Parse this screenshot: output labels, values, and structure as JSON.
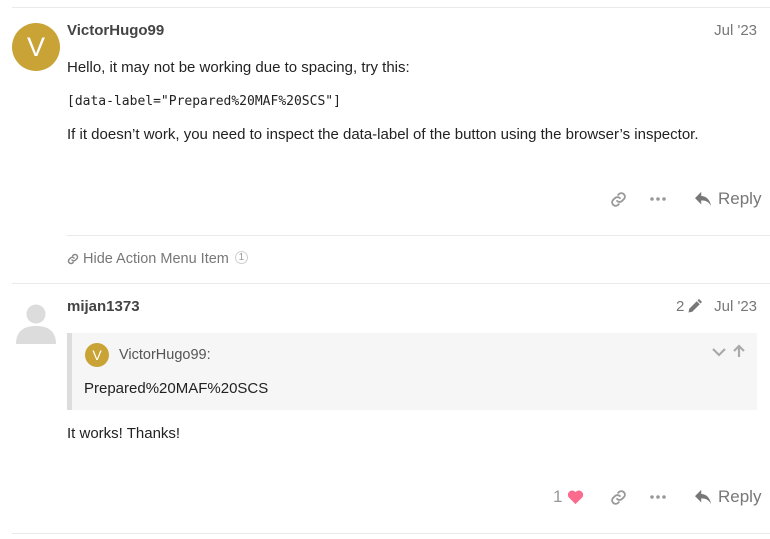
{
  "posts": [
    {
      "avatar_letter": "V",
      "avatar_color": "#c9a336",
      "username": "VictorHugo99",
      "date": "Jul '23",
      "intro": "Hello, it may not be working due to spacing, try this:",
      "code": "[data-label=\"Prepared%20MAF%20SCS\"]",
      "outro": "If it doesn’t work, you need to inspect the data-label of the button using the browser’s inspector.",
      "reply_label": "Reply",
      "link": {
        "title": "Hide Action Menu Item",
        "count": "1"
      }
    },
    {
      "username": "mijan1373",
      "edit_count": "2",
      "date": "Jul '23",
      "quote": {
        "avatar_letter": "V",
        "user": "VictorHugo99:",
        "text": "Prepared%20MAF%20SCS"
      },
      "body": "It works! Thanks!",
      "like_count": "1",
      "like_color": "#fa6c8d",
      "reply_label": "Reply"
    }
  ]
}
